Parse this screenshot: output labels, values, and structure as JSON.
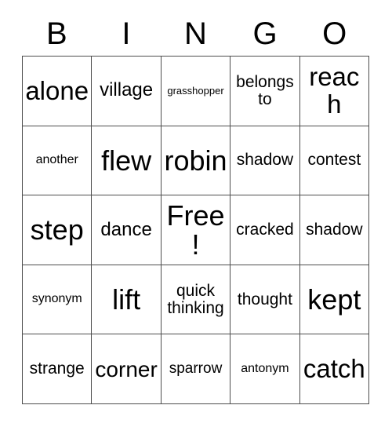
{
  "card": {
    "header_letters": [
      "B",
      "I",
      "N",
      "G",
      "O"
    ],
    "free_space_label": "Free!",
    "colors": {
      "background": "#ffffff",
      "text": "#000000",
      "grid_line": "#4d4d4d"
    },
    "rows": [
      [
        {
          "label": "alone",
          "size": "fs-xxl"
        },
        {
          "label": "village",
          "size": "fs-l"
        },
        {
          "label": "grasshopper",
          "size": "fs-xs"
        },
        {
          "label": "belongs to",
          "size": "fs-ml"
        },
        {
          "label": "reach",
          "size": "fs-xxl"
        }
      ],
      [
        {
          "label": "another",
          "size": "fs-s"
        },
        {
          "label": "flew",
          "size": "fs-huge"
        },
        {
          "label": "robin",
          "size": "fs-huge"
        },
        {
          "label": "shadow",
          "size": "fs-ml"
        },
        {
          "label": "contest",
          "size": "fs-ml"
        }
      ],
      [
        {
          "label": "step",
          "size": "fs-huge"
        },
        {
          "label": "dance",
          "size": "fs-l"
        },
        {
          "label": "Free!",
          "size": "fs-huge"
        },
        {
          "label": "cracked",
          "size": "fs-ml"
        },
        {
          "label": "shadow",
          "size": "fs-ml"
        }
      ],
      [
        {
          "label": "synonym",
          "size": "fs-s"
        },
        {
          "label": "lift",
          "size": "fs-huge"
        },
        {
          "label": "quick thinking",
          "size": "fs-ml"
        },
        {
          "label": "thought",
          "size": "fs-ml"
        },
        {
          "label": "kept",
          "size": "fs-huge"
        }
      ],
      [
        {
          "label": "strange",
          "size": "fs-ml"
        },
        {
          "label": "corner",
          "size": "fs-xl"
        },
        {
          "label": "sparrow",
          "size": "fs-m"
        },
        {
          "label": "antonym",
          "size": "fs-s"
        },
        {
          "label": "catch",
          "size": "fs-xxl"
        }
      ]
    ]
  }
}
